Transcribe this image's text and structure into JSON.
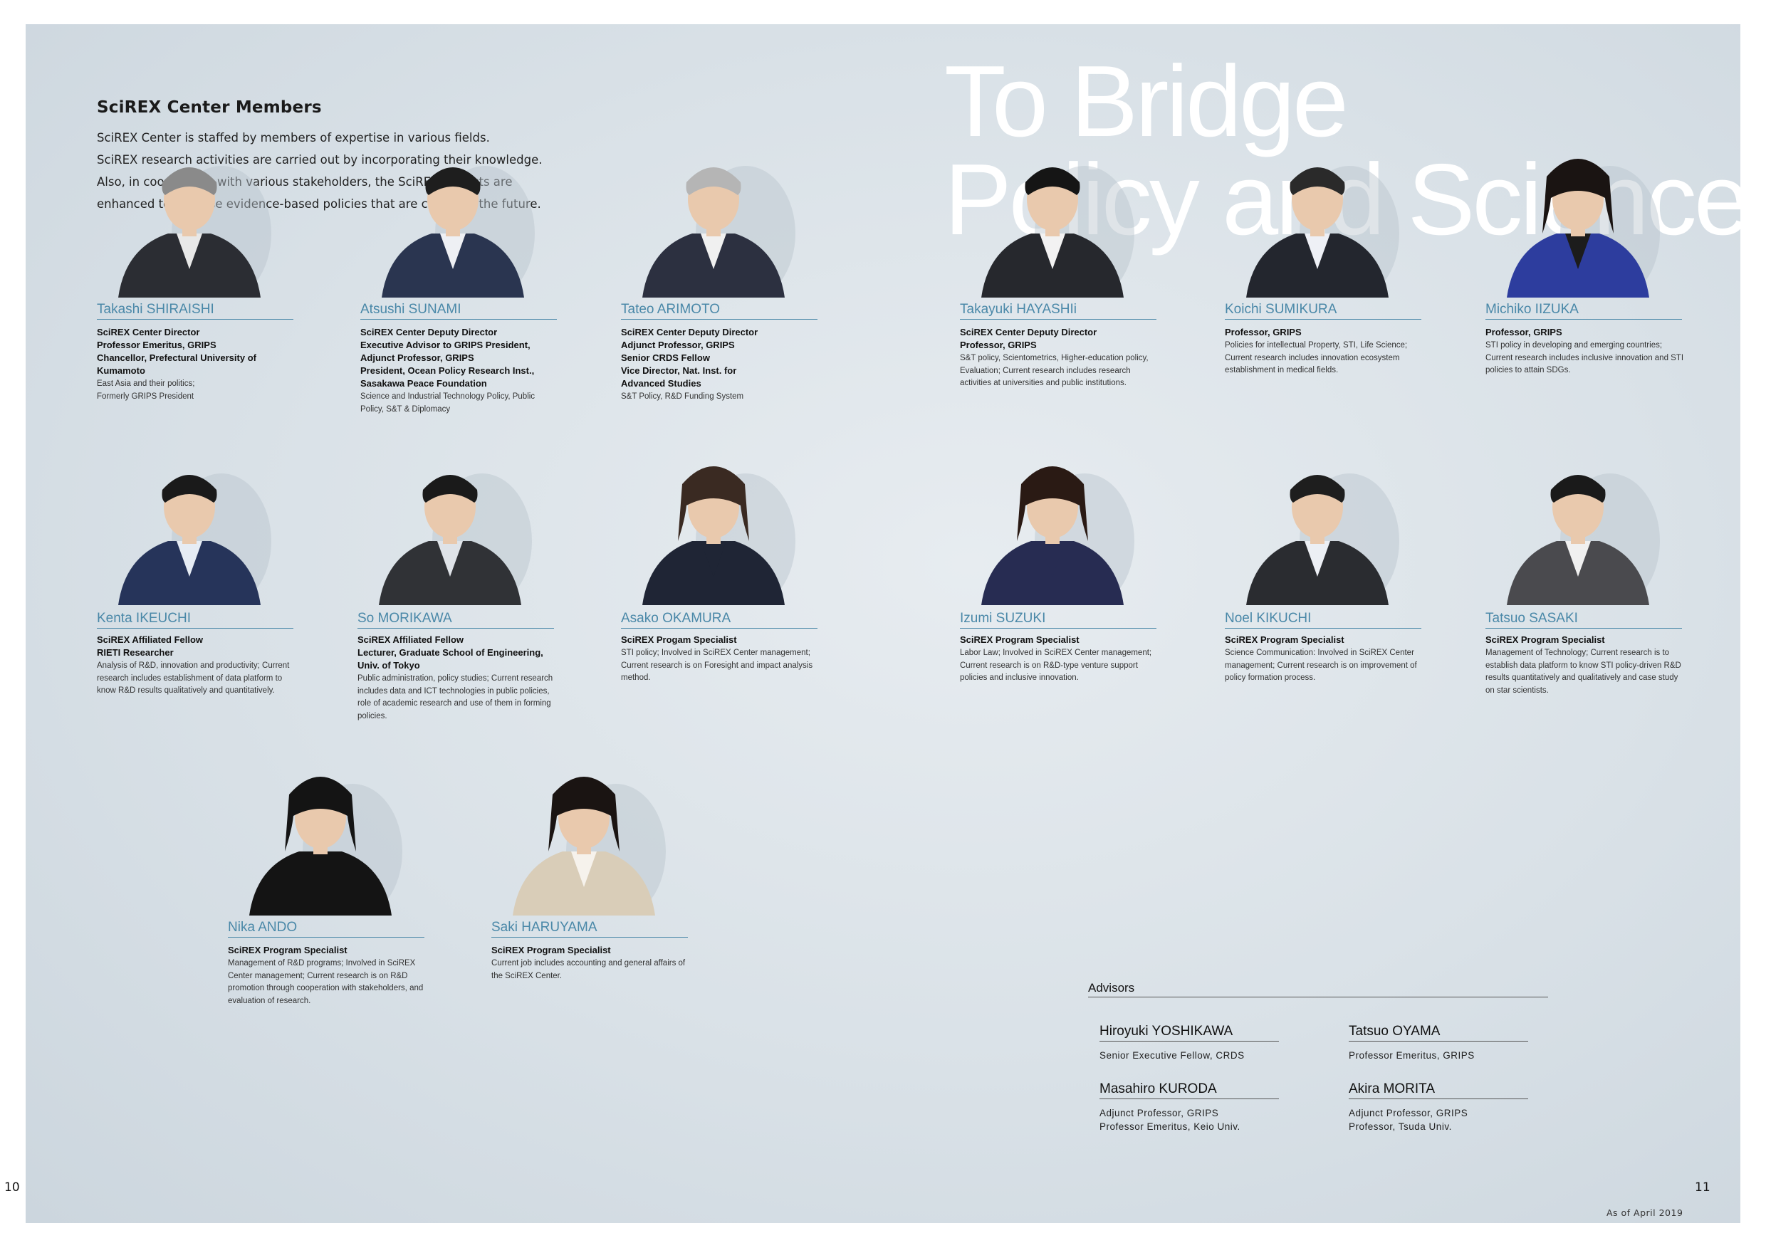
{
  "intro": {
    "title": "SciREX Center Members",
    "lines": [
      "SciREX Center is staffed by members of expertise in various fields.",
      "SciREX research activities are carried out by incorporating their knowledge.",
      "Also, in cooperation with various stakeholders, the SciREX projects are",
      "enhanced to exercise evidence-based policies that are critical in the future."
    ]
  },
  "hero": {
    "line1": "To Bridge",
    "line2": "Policy and Science"
  },
  "members": [
    {
      "name": "Takashi SHIRAISHI",
      "role": "SciREX Center Director\nProfessor Emeritus, GRIPS\nChancellor, Prefectural University of Kumamoto",
      "desc": "East Asia and their politics;\nFormerly GRIPS President",
      "suit": "#2b2d33",
      "hair": "#8a8a8a",
      "shirt": "#e8e8e8"
    },
    {
      "name": "Atsushi SUNAMI",
      "role": "SciREX Center Deputy Director\nExecutive Advisor to GRIPS President,\nAdjunct Professor, GRIPS\nPresident, Ocean Policy Research Inst.,\nSasakawa Peace Foundation",
      "desc": "Science and Industrial Technology Policy, Public Policy, S&T & Diplomacy",
      "suit": "#2a3550",
      "hair": "#1e1e1e",
      "shirt": "#eef0f4"
    },
    {
      "name": "Tateo  ARIMOTO",
      "role": "SciREX Center Deputy Director\nAdjunct Professor, GRIPS\nSenior CRDS Fellow\nVice Director, Nat. Inst. for\nAdvanced Studies",
      "desc": "S&T Policy, R&D Funding System",
      "suit": "#2c3040",
      "hair": "#b5b5b5",
      "shirt": "#f0f0f0"
    },
    {
      "name": "Takayuki HAYASHIi",
      "role": "SciREX Center Deputy Director\nProfessor, GRIPS",
      "desc": "S&T policy, Scientometrics, Higher-education policy, Evaluation; Current research includes research activities at universities and public institutions.",
      "suit": "#26282d",
      "hair": "#151515",
      "shirt": "#f2f2f2"
    },
    {
      "name": "Koichi SUMIKURA",
      "role": "Professor, GRIPS",
      "desc": "Policies for intellectual Property, STI, Life Science;  Current research includes innovation ecosystem establishment in medical fields.",
      "suit": "#23262e",
      "hair": "#2a2a2a",
      "shirt": "#eef0f6"
    },
    {
      "name": "Michiko IIZUKA",
      "role": "Professor, GRIPS",
      "desc": "STI policy in developing and emerging countries; Current research includes inclusive  innovation and STI policies to attain SDGs.",
      "suit": "#2d3d9e",
      "hair": "#1a1412",
      "shirt": "#1c1c1c"
    },
    {
      "name": "Kenta IKEUCHI",
      "role": "SciREX Affiliated Fellow\nRIETI Researcher",
      "desc": "Analysis of R&D, innovation and productivity; Current research includes establishment of data platform to know R&D results qualitatively and quantitatively.",
      "suit": "#26345a",
      "hair": "#1a1a1a",
      "shirt": "#e6ecf4"
    },
    {
      "name": "So  MORIKAWA",
      "role": "SciREX Affiliated Fellow\nLecturer, Graduate School of Engineering,\nUniv. of Tokyo",
      "desc": "Public administration, policy studies; Current research includes data and ICT technologies in public policies, role of academic research and use of them in forming policies.",
      "suit": "#303236",
      "hair": "#1a1a1a",
      "shirt": "#dfe3e8"
    },
    {
      "name": "Asako OKAMURA",
      "role": "SciREX Progam Specialist",
      "desc": "STI policy; Involved in SciREX Center management; Current research is on Foresight and impact analysis method.",
      "suit": "#1f2535",
      "hair": "#3a2a22",
      "shirt": "#1f2535"
    },
    {
      "name": "Izumi SUZUKI",
      "role": "SciREX Program Specialist",
      "desc": "Labor Law; Involved in SciREX Center management; Current research is on R&D-type venture support policies and inclusive innovation.",
      "suit": "#272c52",
      "hair": "#2a1a14",
      "shirt": "#272c52"
    },
    {
      "name": "Noel KIKUCHI",
      "role": "SciREX Program Specialist",
      "desc": "Science Communication: Involved in SciREX Center management; Current research is on improvement of policy formation process.",
      "suit": "#2a2c30",
      "hair": "#1e1e1e",
      "shirt": "#eceff4"
    },
    {
      "name": "Tatsuo SASAKI",
      "role": "SciREX Program Specialist",
      "desc": "Management of Technology; Current research is to establish data platform to know STI policy-driven R&D results quantitatively and qualitatively and case study on star scientists.",
      "suit": "#4a4a4e",
      "hair": "#1a1a1a",
      "shirt": "#f0f0f0"
    },
    {
      "name": "Nika ANDO",
      "role": "SciREX Program Specialist",
      "desc": "Management of R&D programs; Involved in SciREX Center management; Current research is on R&D promotion through cooperation with stakeholders, and evaluation of  research.",
      "suit": "#141414",
      "hair": "#141414",
      "shirt": "#141414"
    },
    {
      "name": "Saki HARUYAMA",
      "role": "SciREX Program Specialist",
      "desc": "Current job includes accounting and general affairs of the SciREX Center.",
      "suit": "#d9cdb8",
      "hair": "#1a1412",
      "shirt": "#f6f2ec"
    }
  ],
  "advisors": {
    "title": "Advisors",
    "items": [
      {
        "name": "Hiroyuki YOSHIKAWA",
        "role": "Senior Executive Fellow, CRDS"
      },
      {
        "name": "Tatsuo OYAMA",
        "role": "Professor Emeritus, GRIPS"
      },
      {
        "name": "Masahiro KURODA",
        "role": "Adjunct Professor, GRIPS\nProfessor Emeritus, Keio Univ."
      },
      {
        "name": "Akira MORITA",
        "role": "Adjunct Professor, GRIPS\nProfessor, Tsuda Univ."
      }
    ]
  },
  "footer": {
    "page_left": "10",
    "page_right": "11",
    "as_of": "As of April 2019"
  }
}
